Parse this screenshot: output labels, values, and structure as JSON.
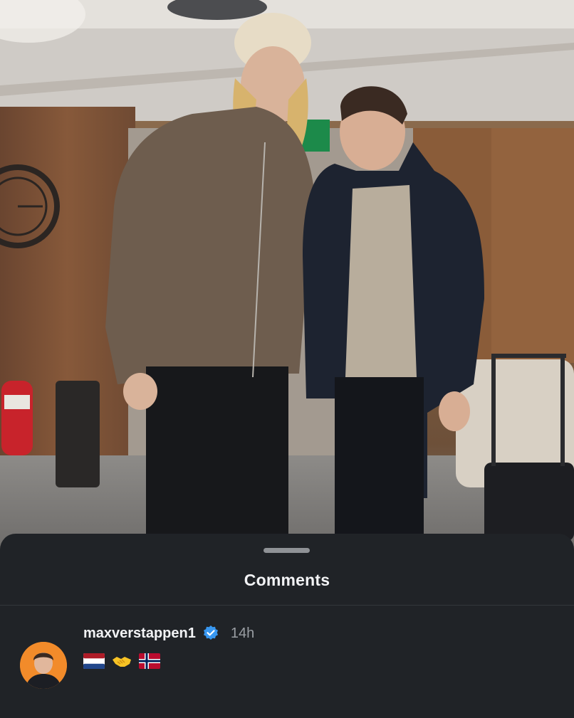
{
  "photo": {
    "description_icon": "photo-of-two-people"
  },
  "comments_sheet": {
    "title": "Comments",
    "comments": [
      {
        "username": "maxverstappen1",
        "verified": true,
        "timestamp": "14h",
        "body_icons": [
          "netherlands-flag-icon",
          "handshake-icon",
          "norway-flag-icon"
        ]
      }
    ]
  },
  "colors": {
    "sheet_background": "#202327",
    "verified_blue": "#3897f0",
    "avatar_orange": "#f28b2a"
  }
}
